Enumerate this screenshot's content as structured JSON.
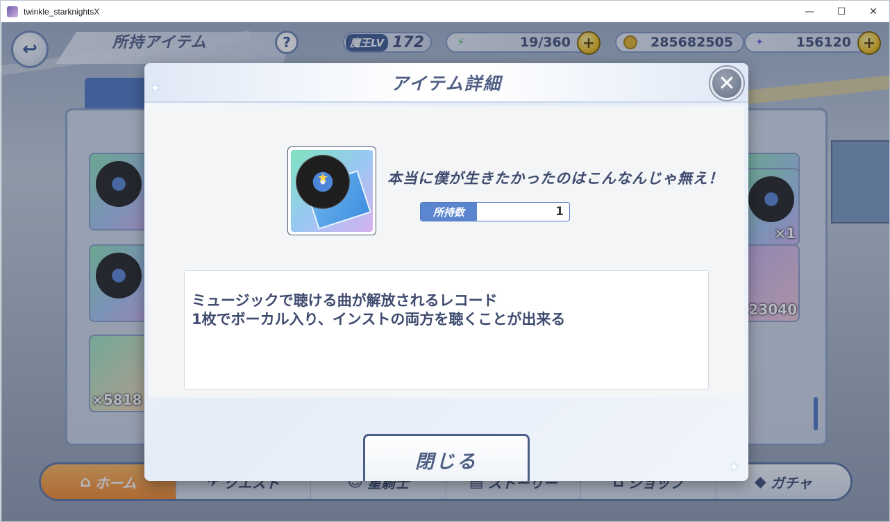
{
  "window": {
    "title": "twinkle_starknightsX",
    "minimize": "—",
    "maximize": "☐",
    "close": "✕"
  },
  "hud": {
    "back_icon": "↩",
    "title": "所持アイテム",
    "help": "?",
    "level_label": "魔王LV",
    "level_value": "172",
    "stamina": "19/360",
    "coins": "285682505",
    "gems": "156120",
    "plus": "+"
  },
  "inventory": {
    "slot_counts": [
      "×1",
      "×1",
      "23040",
      "×5818"
    ]
  },
  "nav": {
    "items": [
      {
        "label": "ホーム",
        "icon": "home-icon",
        "glyph": "⌂"
      },
      {
        "label": "クエスト",
        "icon": "quest-icon",
        "glyph": "✈"
      },
      {
        "label": "星騎士",
        "icon": "knight-icon",
        "glyph": "☺"
      },
      {
        "label": "ストーリー",
        "icon": "story-icon",
        "glyph": "▤"
      },
      {
        "label": "ショップ",
        "icon": "shop-icon",
        "glyph": "⌂"
      },
      {
        "label": "ガチャ",
        "icon": "gacha-icon",
        "glyph": "◆"
      }
    ]
  },
  "modal": {
    "title": "アイテム詳細",
    "close_icon": "✕",
    "item_name": "本当に僕が生きたかったのはこんなんじゃ無え！",
    "owned_label": "所持数",
    "owned_value": "1",
    "description_line1": "ミュージックで聴ける曲が解放されるレコード",
    "description_line2": "1枚でボーカル入り、インストの両方を聴くことが出来る",
    "close_button": "閉じる"
  }
}
